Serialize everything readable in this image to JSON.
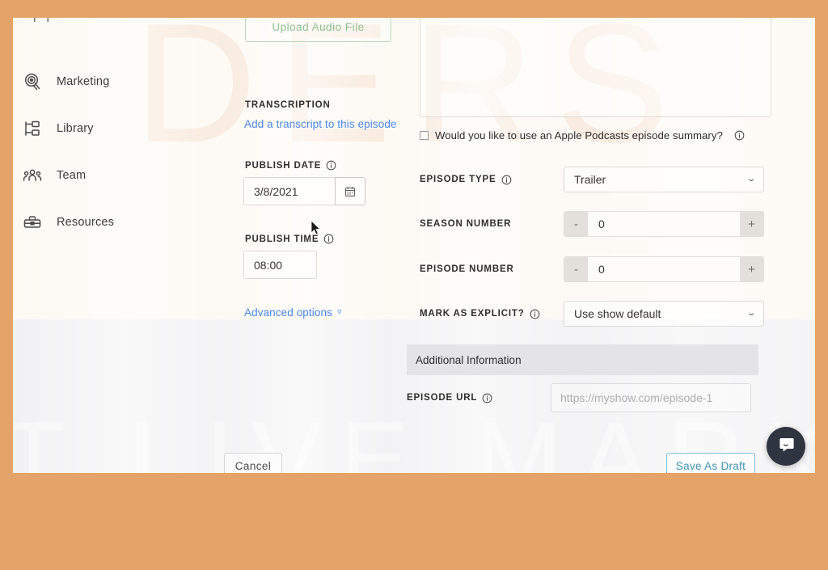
{
  "frame": {
    "accent_color": "#e3a369",
    "content_bg_top": "#fdf9f3",
    "content_bg_bottom": "#f1f1f3"
  },
  "watermark": {
    "top_text": "DERS",
    "bottom_text": "T LIVE MARK"
  },
  "sidebar": {
    "items": [
      {
        "label": "Marketing",
        "icon": "megaphone-icon"
      },
      {
        "label": "Library",
        "icon": "library-icon"
      },
      {
        "label": "Team",
        "icon": "team-icon"
      },
      {
        "label": "Resources",
        "icon": "toolbox-icon"
      }
    ]
  },
  "form": {
    "upload_button": "Upload Audio File",
    "transcription": {
      "label": "TRANSCRIPTION",
      "link": "Add a transcript to this episode"
    },
    "publish_date": {
      "label": "PUBLISH DATE",
      "value": "3/8/2021",
      "calendar_icon": "calendar-icon"
    },
    "publish_time": {
      "label": "PUBLISH TIME",
      "value": "08:00"
    },
    "advanced_options": {
      "label": "Advanced options",
      "chevron": "▿"
    },
    "description": {
      "value": ""
    },
    "apple_summary": {
      "label": "Would you like to use an Apple Podcasts episode summary?",
      "checked": false
    },
    "episode_type": {
      "label": "EPISODE TYPE",
      "value": "Trailer"
    },
    "season_number": {
      "label": "SEASON NUMBER",
      "value": "0",
      "minus": "-",
      "plus": "+"
    },
    "episode_number": {
      "label": "EPISODE NUMBER",
      "value": "0",
      "minus": "-",
      "plus": "+"
    },
    "mark_explicit": {
      "label": "MARK AS EXPLICIT?",
      "value": "Use show default"
    }
  },
  "additional_information": {
    "heading": "Additional Information",
    "episode_url": {
      "label": "EPISODE URL",
      "value": "",
      "placeholder": "https://myshow.com/episode-1"
    }
  },
  "footer": {
    "cancel_label": "Cancel",
    "save_label": "Save As Draft"
  },
  "chat": {
    "icon": "chat-bubble-icon"
  }
}
